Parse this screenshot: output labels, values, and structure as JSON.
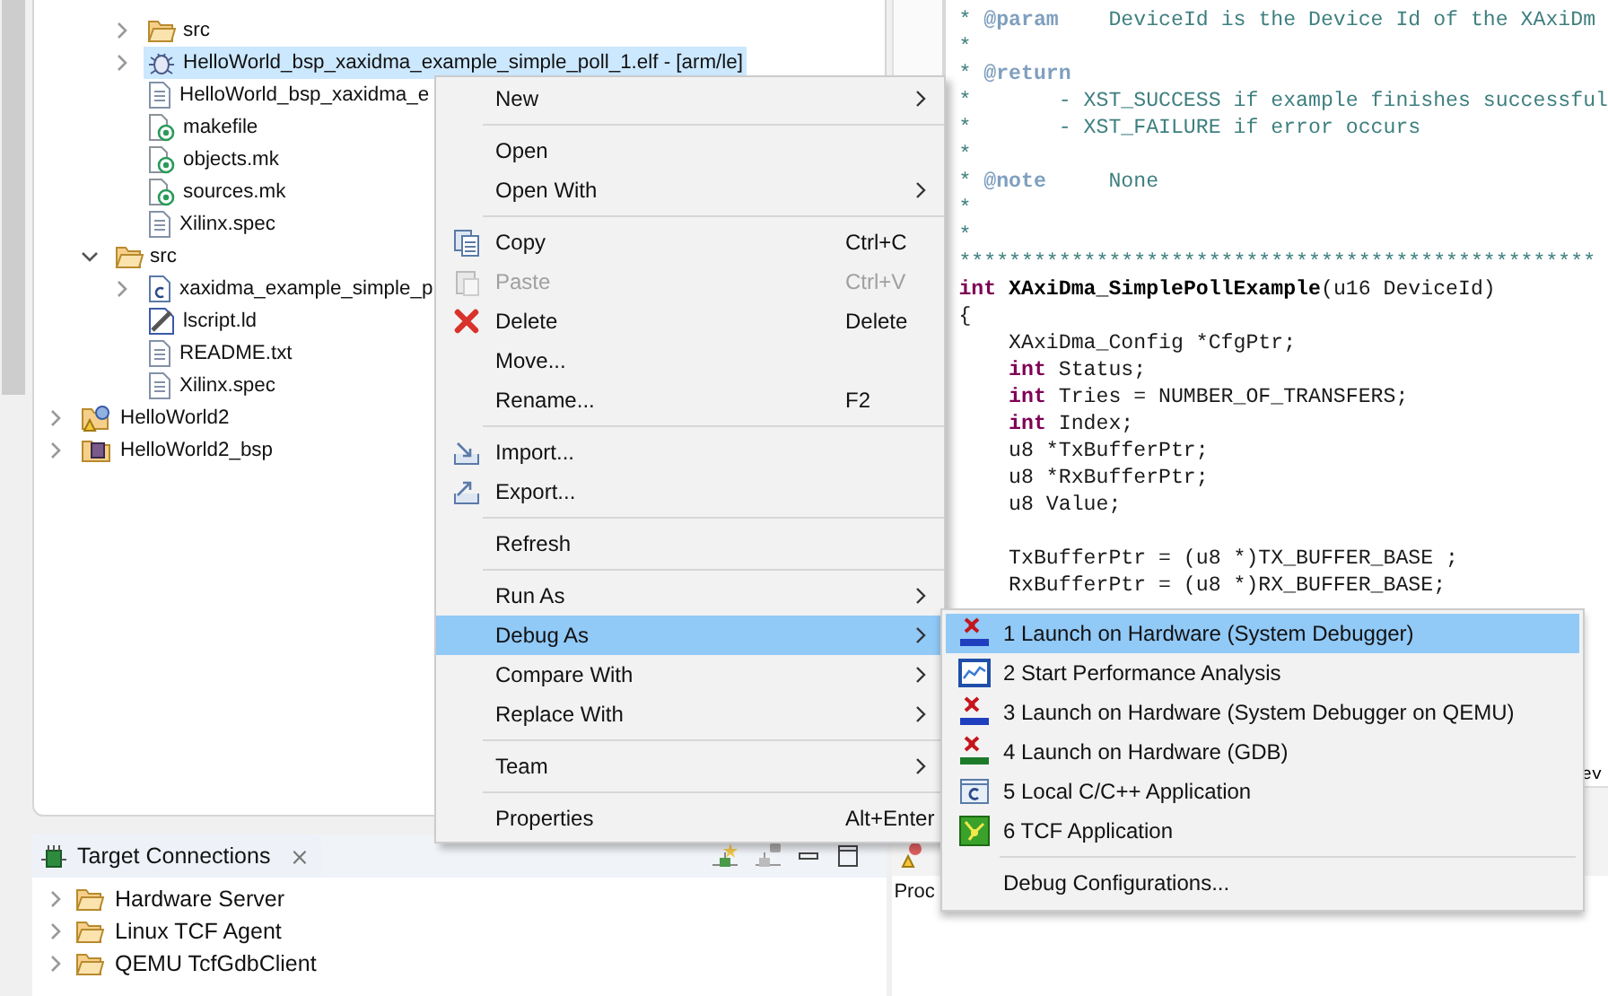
{
  "project_tree": [
    {
      "children": [
        {
          "children": [
            {
              "label": "src",
              "kind": "folder",
              "expanded": false,
              "selected": false
            },
            {
              "label": "HelloWorld_bsp_xaxidma_example_simple_poll_1.elf - [arm/le]",
              "kind": "binary",
              "expanded": false,
              "selected": true
            },
            {
              "label": "HelloWorld_bsp_xaxidma_e",
              "kind": "text",
              "selected": false
            },
            {
              "label": "makefile",
              "kind": "make",
              "selected": false
            },
            {
              "label": "objects.mk",
              "kind": "make",
              "selected": false
            },
            {
              "label": "sources.mk",
              "kind": "make",
              "selected": false
            },
            {
              "label": "Xilinx.spec",
              "kind": "text",
              "selected": false
            }
          ]
        },
        {
          "label": "src",
          "kind": "folder",
          "expanded": true,
          "selected": false,
          "children": [
            {
              "label": "xaxidma_example_simple_p",
              "kind": "c-source",
              "expanded": false,
              "selected": false
            },
            {
              "label": "lscript.ld",
              "kind": "linker",
              "selected": false
            },
            {
              "label": "README.txt",
              "kind": "text",
              "selected": false
            },
            {
              "label": "Xilinx.spec",
              "kind": "text",
              "selected": false
            }
          ]
        }
      ]
    },
    {
      "label": "HelloWorld2",
      "kind": "project",
      "expanded": false,
      "selected": false
    },
    {
      "label": "HelloWorld2_bsp",
      "kind": "bsp",
      "expanded": false,
      "selected": false
    }
  ],
  "target_connections": {
    "title": "Target Connections",
    "close": "⨯",
    "items": [
      {
        "label": "Hardware Server",
        "expanded": false
      },
      {
        "label": "Linux TCF Agent",
        "expanded": false
      },
      {
        "label": "QEMU TcfGdbClient",
        "expanded": false
      }
    ]
  },
  "editor": {
    "lines": [
      [
        {
          "text": "* ",
          "kind": "comment"
        },
        {
          "text": "@param",
          "kind": "tag"
        },
        {
          "text": "    DeviceId is the Device Id of the XAxiDm",
          "kind": "comment"
        }
      ],
      [
        {
          "text": "*",
          "kind": "comment"
        }
      ],
      [
        {
          "text": "* ",
          "kind": "comment"
        },
        {
          "text": "@return",
          "kind": "tag"
        }
      ],
      [
        {
          "text": "*       - XST_SUCCESS if example finishes successful",
          "kind": "comment"
        }
      ],
      [
        {
          "text": "*       - XST_FAILURE if error occurs",
          "kind": "comment"
        }
      ],
      [
        {
          "text": "*",
          "kind": "comment"
        }
      ],
      [
        {
          "text": "* ",
          "kind": "comment"
        },
        {
          "text": "@note",
          "kind": "tag"
        },
        {
          "text": "     None",
          "kind": "comment"
        }
      ],
      [
        {
          "text": "*",
          "kind": "comment"
        }
      ],
      [
        {
          "text": "*",
          "kind": "comment"
        }
      ],
      [
        {
          "text": "***************************************************",
          "kind": "comment"
        }
      ],
      [
        {
          "text": "int",
          "kind": "keyword"
        },
        {
          "text": " XAxiDma_SimplePollExample",
          "kind": "function"
        },
        {
          "text": "(u16 DeviceId)",
          "kind": "plain"
        }
      ],
      [
        {
          "text": "{",
          "kind": "plain"
        }
      ],
      [
        {
          "text": "    XAxiDma_Config *CfgPtr;",
          "kind": "plain"
        }
      ],
      [
        {
          "text": "    int",
          "kind": "keyword"
        },
        {
          "text": " Status;",
          "kind": "plain"
        }
      ],
      [
        {
          "text": "    int",
          "kind": "keyword"
        },
        {
          "text": " Tries = NUMBER_OF_TRANSFERS;",
          "kind": "plain"
        }
      ],
      [
        {
          "text": "    int",
          "kind": "keyword"
        },
        {
          "text": " Index;",
          "kind": "plain"
        }
      ],
      [
        {
          "text": "    u8 *TxBufferPtr;",
          "kind": "plain"
        }
      ],
      [
        {
          "text": "    u8 *RxBufferPtr;",
          "kind": "plain"
        }
      ],
      [
        {
          "text": "    u8 Value;",
          "kind": "plain"
        }
      ],
      [
        {
          "text": "    TxBufferPtr = (u8 *)TX_BUFFER_BASE ;",
          "kind": "plain"
        }
      ],
      [
        {
          "text": "    RxBufferPtr = (u8 *)RX_BUFFER_BASE;",
          "kind": "plain"
        }
      ]
    ],
    "covered_line_fragment": "ev"
  },
  "bottom_panel": {
    "tab": "Proc"
  },
  "context_menu": [
    {
      "kind": "plain",
      "label": "New",
      "has_submenu": true,
      "disabled": false,
      "selected": false
    },
    {
      "kind": "separator"
    },
    {
      "kind": "plain",
      "label": "Open",
      "has_submenu": false,
      "disabled": false,
      "selected": false
    },
    {
      "kind": "plain",
      "label": "Open With",
      "has_submenu": true,
      "disabled": false,
      "selected": false
    },
    {
      "kind": "separator"
    },
    {
      "kind": "copy",
      "label": "Copy",
      "shortcut": "Ctrl+C",
      "has_submenu": false,
      "disabled": false,
      "selected": false
    },
    {
      "kind": "paste",
      "label": "Paste",
      "shortcut": "Ctrl+V",
      "has_submenu": false,
      "disabled": true,
      "selected": false
    },
    {
      "kind": "delete",
      "label": "Delete",
      "shortcut": "Delete",
      "has_submenu": false,
      "disabled": false,
      "selected": false
    },
    {
      "kind": "plain",
      "label": "Move...",
      "has_submenu": false,
      "disabled": false,
      "selected": false
    },
    {
      "kind": "plain",
      "label": "Rename...",
      "shortcut": "F2",
      "has_submenu": false,
      "disabled": false,
      "selected": false
    },
    {
      "kind": "separator"
    },
    {
      "kind": "import",
      "label": "Import...",
      "has_submenu": false,
      "disabled": false,
      "selected": false
    },
    {
      "kind": "export",
      "label": "Export...",
      "has_submenu": false,
      "disabled": false,
      "selected": false
    },
    {
      "kind": "separator"
    },
    {
      "kind": "plain",
      "label": "Refresh",
      "has_submenu": false,
      "disabled": false,
      "selected": false
    },
    {
      "kind": "separator"
    },
    {
      "kind": "plain",
      "label": "Run As",
      "has_submenu": true,
      "disabled": false,
      "selected": false
    },
    {
      "kind": "plain",
      "label": "Debug As",
      "has_submenu": true,
      "disabled": false,
      "selected": true
    },
    {
      "kind": "plain",
      "label": "Compare With",
      "has_submenu": true,
      "disabled": false,
      "selected": false
    },
    {
      "kind": "plain",
      "label": "Replace With",
      "has_submenu": true,
      "disabled": false,
      "selected": false
    },
    {
      "kind": "separator"
    },
    {
      "kind": "plain",
      "label": "Team",
      "has_submenu": true,
      "disabled": false,
      "selected": false
    },
    {
      "kind": "separator"
    },
    {
      "kind": "plain",
      "label": "Properties",
      "shortcut": "Alt+Enter",
      "has_submenu": false,
      "disabled": false,
      "selected": false
    }
  ],
  "debug_as_submenu": [
    {
      "kind": "tcf",
      "label": "1 Launch on Hardware (System Debugger)",
      "selected": true
    },
    {
      "kind": "performance",
      "label": "2 Start Performance Analysis",
      "selected": false
    },
    {
      "kind": "tcf",
      "label": "3 Launch on Hardware (System Debugger on QEMU)",
      "selected": false
    },
    {
      "kind": "gdb",
      "label": "4 Launch on Hardware (GDB)",
      "selected": false
    },
    {
      "kind": "c-app",
      "label": "5 Local C/C++ Application",
      "selected": false
    },
    {
      "kind": "tcf-app",
      "label": "6 TCF Application",
      "selected": false
    },
    {
      "kind": "separator"
    },
    {
      "kind": "plain",
      "label": "Debug Configurations...",
      "selected": false
    }
  ]
}
